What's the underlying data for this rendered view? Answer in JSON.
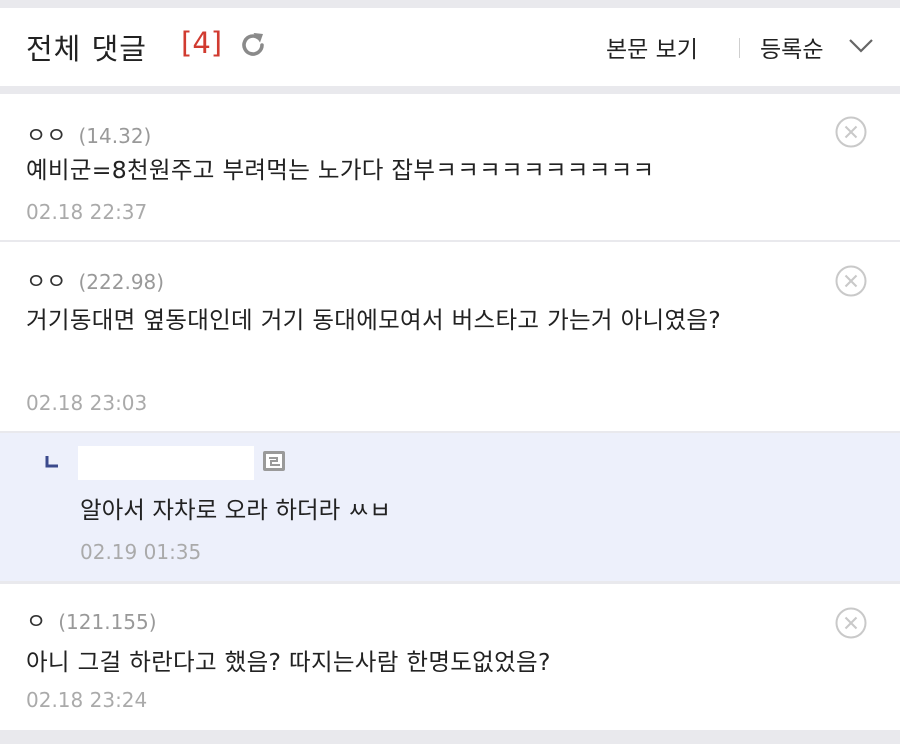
{
  "header": {
    "title": "전체 댓글",
    "count": "[4]",
    "view_body_label": "본문 보기",
    "sort_label": "등록순"
  },
  "comments": [
    {
      "nick": "ㅇㅇ",
      "ip": "(14.32)",
      "text": "예비군=8천원주고 부려먹는 노가다 잡부ㅋㅋㅋㅋㅋㅋㅋㅋㅋㅋ",
      "date": "02.18 22:37"
    },
    {
      "nick": "ㅇㅇ",
      "ip": "(222.98)",
      "text": "거기동대면 옆동대인데 거기 동대에모여서 버스타고 가는거 아니였음?",
      "date": "02.18 23:03"
    },
    {
      "nick": "ㅇ",
      "ip": "(121.155)",
      "text": "아니 그걸 하란다고 했음? 따지는사람 한명도없었음?",
      "date": "02.18 23:24"
    }
  ],
  "reply": {
    "text": "알아서 자차로 오라 하더라 ㅆㅂ",
    "date": "02.19 01:35"
  },
  "icons": {
    "refresh": "refresh-icon",
    "sort": "chevron-down-icon",
    "delete": "delete-circle-x-icon",
    "reply": "reply-arrow-icon",
    "gallog": "gallog-icon"
  },
  "colors": {
    "count": "#d13b30",
    "reply_bg": "#edf0fb",
    "reply_arrow": "#3b4a8c"
  }
}
